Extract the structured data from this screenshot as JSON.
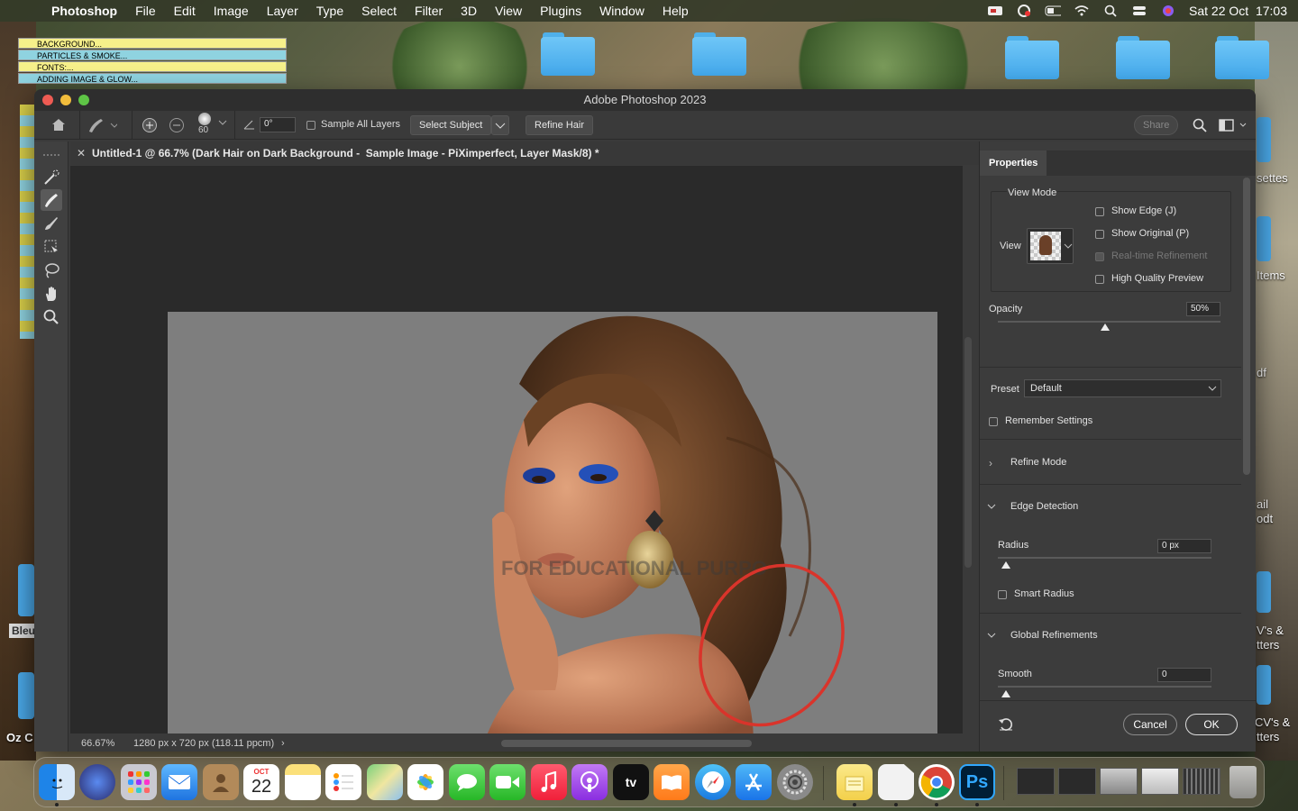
{
  "menubar": {
    "app_name": "Photoshop",
    "items": [
      "File",
      "Edit",
      "Image",
      "Layer",
      "Type",
      "Select",
      "Filter",
      "3D",
      "View",
      "Plugins",
      "Window",
      "Help"
    ],
    "clock": "Sat 22 Oct  17:03"
  },
  "desktop": {
    "stickies": [
      "BACKGROUND...",
      "PARTICLES & SMOKE...",
      "FONTS:...",
      "ADDING IMAGE & GLOW..."
    ],
    "labels": {
      "settes": "settes",
      "items": "Items",
      "df": "df",
      "ail": "ail",
      "odt": "odt",
      "vs1": "V's &",
      "tters1": "tters",
      "vs2": "CV's &",
      "tters2": "tters",
      "bleu": "Bleu",
      "ozc": "Oz C"
    }
  },
  "window": {
    "title": "Adobe Photoshop 2023",
    "options": {
      "brush_size": "60",
      "angle": "0°",
      "sample_all_layers": "Sample All Layers",
      "select_subject": "Select Subject",
      "refine_hair": "Refine Hair",
      "share": "Share"
    },
    "doc_tab": "Untitled-1 @ 66.7% (Dark Hair on Dark Background -  Sample Image - PiXimperfect, Layer Mask/8) *",
    "watermark": "FOR EDUCATIONAL PURPO",
    "status": {
      "zoom": "66.67%",
      "doc_info": "1280 px x 720 px (118.11 ppcm)"
    },
    "tools": [
      "quick-selection-tool",
      "refine-edge-brush-tool",
      "brush-tool",
      "object-selection-tool",
      "lasso-tool",
      "hand-tool",
      "zoom-tool"
    ]
  },
  "properties": {
    "tab": "Properties",
    "view_mode": {
      "title": "View Mode",
      "view_label": "View",
      "show_edge": "Show Edge (J)",
      "show_original": "Show Original (P)",
      "realtime": "Real-time Refinement",
      "hq_preview": "High Quality Preview"
    },
    "opacity": {
      "label": "Opacity",
      "value": "50%",
      "level": 0.5
    },
    "preset": {
      "label": "Preset",
      "value": "Default"
    },
    "remember": "Remember Settings",
    "refine_mode": "Refine Mode",
    "edge_detection": {
      "title": "Edge Detection",
      "radius_label": "Radius",
      "radius_value": "0 px",
      "smart_radius": "Smart Radius"
    },
    "global": {
      "title": "Global Refinements",
      "smooth_label": "Smooth",
      "smooth_value": "0"
    },
    "cancel": "Cancel",
    "ok": "OK"
  },
  "dock": {
    "calendar_month": "OCT",
    "calendar_day": "22",
    "ps_label": "Ps",
    "tv_label": "tv"
  },
  "colors": {
    "highlight_circle": "#d9342b",
    "folder": "#5bbcf5",
    "accent": "#2f7bd6"
  }
}
